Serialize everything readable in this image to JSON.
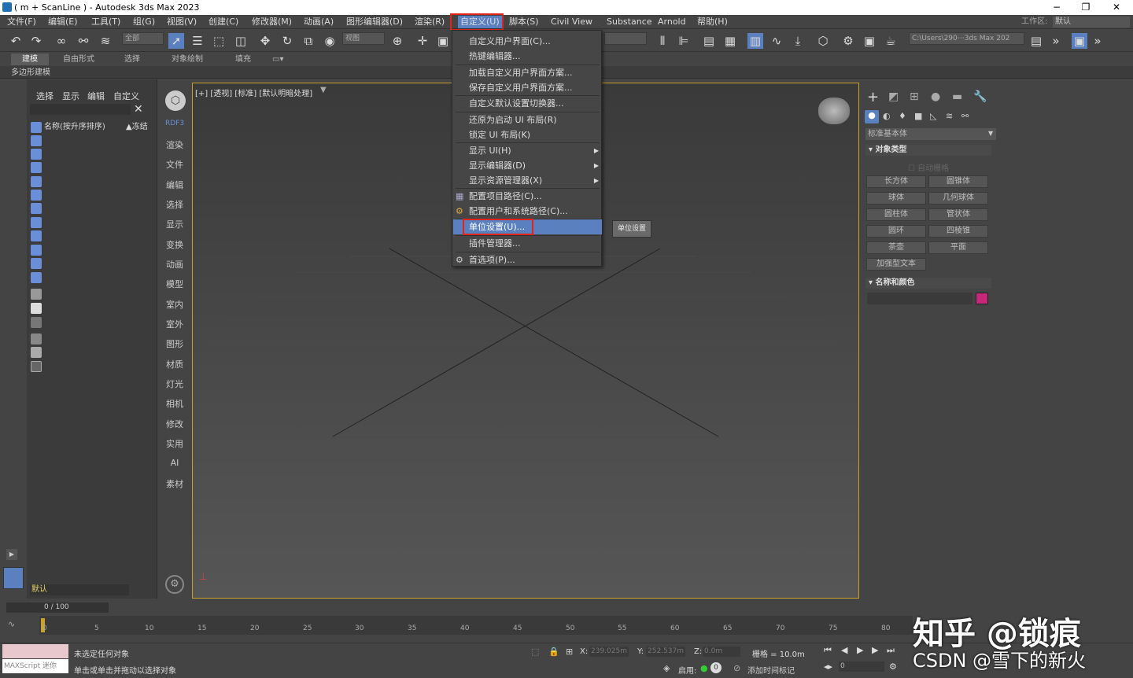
{
  "window": {
    "title": "( m + ScanLine ) - Autodesk 3ds Max 2023",
    "minimize": "−",
    "maximize": "❐",
    "close": "✕"
  },
  "menubar": {
    "items": [
      "文件(F)",
      "编辑(E)",
      "工具(T)",
      "组(G)",
      "视图(V)",
      "创建(C)",
      "修改器(M)",
      "动画(A)",
      "图形编辑器(D)",
      "渲染(R)",
      "自定义(U)",
      "脚本(S)",
      "Civil View",
      "Substance",
      "Arnold",
      "帮助(H)"
    ],
    "workspace_label": "工作区:",
    "workspace_value": "默认"
  },
  "toolbar": {
    "selection_filter": "全部",
    "view_dropdown": "视图",
    "path": "C:\\Users\\290⋯3ds Max 202"
  },
  "ribbon": {
    "tabs": [
      "建模",
      "自由形式",
      "选择",
      "对象绘制",
      "填充"
    ],
    "sub": "多边形建模"
  },
  "scene_explorer": {
    "menus": [
      "选择",
      "显示",
      "编辑",
      "自定义"
    ],
    "column_name": "名称(按升序排序)",
    "column_frozen": "▲冻结",
    "layer": "默认"
  },
  "categories": [
    "RDF3",
    "渲染",
    "文件",
    "编辑",
    "选择",
    "显示",
    "变换",
    "动画",
    "模型",
    "室内",
    "室外",
    "图形",
    "材质",
    "灯光",
    "相机",
    "修改",
    "实用",
    "AI",
    "素材"
  ],
  "viewport": {
    "label": "[+] [透视] [标准] [默认明暗处理]"
  },
  "dropdown": {
    "items": [
      "自定义用户界面(C)...",
      "热键编辑器...",
      "加载自定义用户界面方案...",
      "保存自定义用户界面方案...",
      "自定义默认设置切换器...",
      "还原为启动 UI 布局(R)",
      "锁定 UI 布局(K)",
      "显示 UI(H)",
      "显示编辑器(D)",
      "显示资源管理器(X)",
      "配置项目路径(C)...",
      "配置用户和系统路径(C)...",
      "单位设置(U)...",
      "插件管理器...",
      "首选项(P)..."
    ]
  },
  "tooltip": "单位设置",
  "cmd_panel": {
    "dropdown": "标准基本体",
    "rollout_object_type": "对象类型",
    "auto_grid": "自动栅格",
    "buttons": [
      "长方体",
      "圆锥体",
      "球体",
      "几何球体",
      "圆柱体",
      "管状体",
      "圆环",
      "四棱锥",
      "茶壶",
      "平面",
      "加强型文本"
    ],
    "rollout_name_color": "名称和颜色",
    "color": "#c8287a"
  },
  "timeline": {
    "frame_counter": "0 / 100",
    "ticks": [
      "0",
      "5",
      "10",
      "15",
      "20",
      "25",
      "30",
      "35",
      "40",
      "45",
      "50",
      "55",
      "60",
      "65",
      "70",
      "75",
      "80"
    ]
  },
  "status": {
    "maxscript": "MAXScript 迷你",
    "line1": "未选定任何对象",
    "line2": "单击或单击并拖动以选择对象",
    "x_label": "X:",
    "x_value": "239.025m",
    "y_label": "Y:",
    "y_value": "252.537m",
    "z_label": "Z:",
    "z_value": "0.0m",
    "grid": "栅格 = 10.0m",
    "enable": "启用:",
    "add_time_tag": "添加时间标记",
    "frame_field": "0"
  },
  "watermark": {
    "line1": "知乎 @锁痕",
    "line2": "CSDN @雪下的新火"
  }
}
